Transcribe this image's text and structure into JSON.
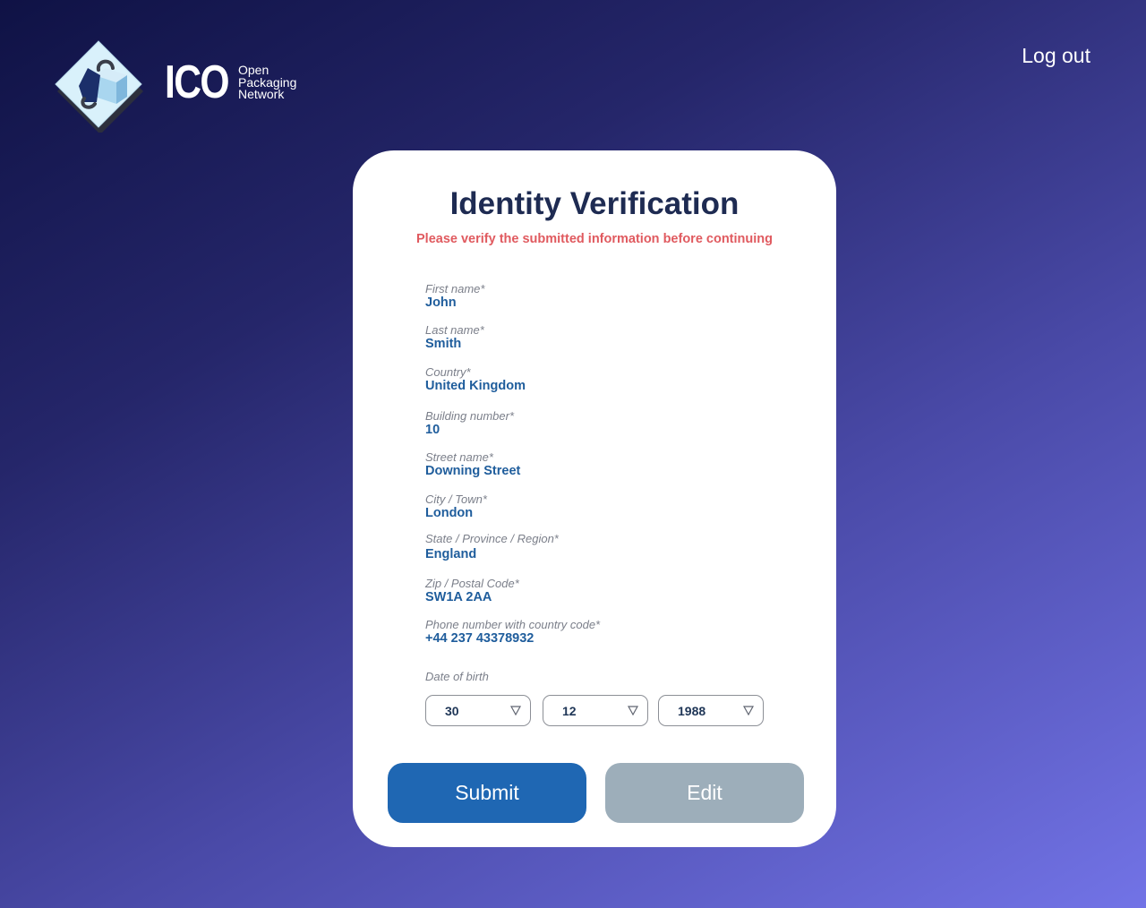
{
  "brand": {
    "name": "ICO",
    "tagline": [
      "Open",
      "Packaging",
      "Network"
    ]
  },
  "header": {
    "logout_label": "Log out"
  },
  "form": {
    "title": "Identity Verification",
    "subtitle": "Please verify the submitted information before continuing",
    "fields": [
      {
        "label": "First name*",
        "value": "John"
      },
      {
        "label": "Last name*",
        "value": "Smith"
      },
      {
        "label": "Country*",
        "value": "United Kingdom"
      },
      {
        "label": "Building number*",
        "value": "10"
      },
      {
        "label": "Street name*",
        "value": "Downing Street"
      },
      {
        "label": "City / Town*",
        "value": "London"
      },
      {
        "label": "State / Province / Region*",
        "value": "England"
      },
      {
        "label": "Zip / Postal Code*",
        "value": "SW1A 2AA"
      },
      {
        "label": "Phone number with country code*",
        "value": "+44 237 43378932"
      }
    ],
    "dob": {
      "label": "Date of birth",
      "day": "30",
      "month": "12",
      "year": "1988"
    },
    "submit_label": "Submit",
    "edit_label": "Edit"
  },
  "colors": {
    "title": "#1e2b52",
    "warning": "#e05a5f",
    "value": "#1f5d9c",
    "submit": "#1f67b3",
    "edit": "#9daeba"
  },
  "icons": {
    "logo": "diamond-cube-lock-icon",
    "select_arrow": "triangle-down-icon"
  }
}
